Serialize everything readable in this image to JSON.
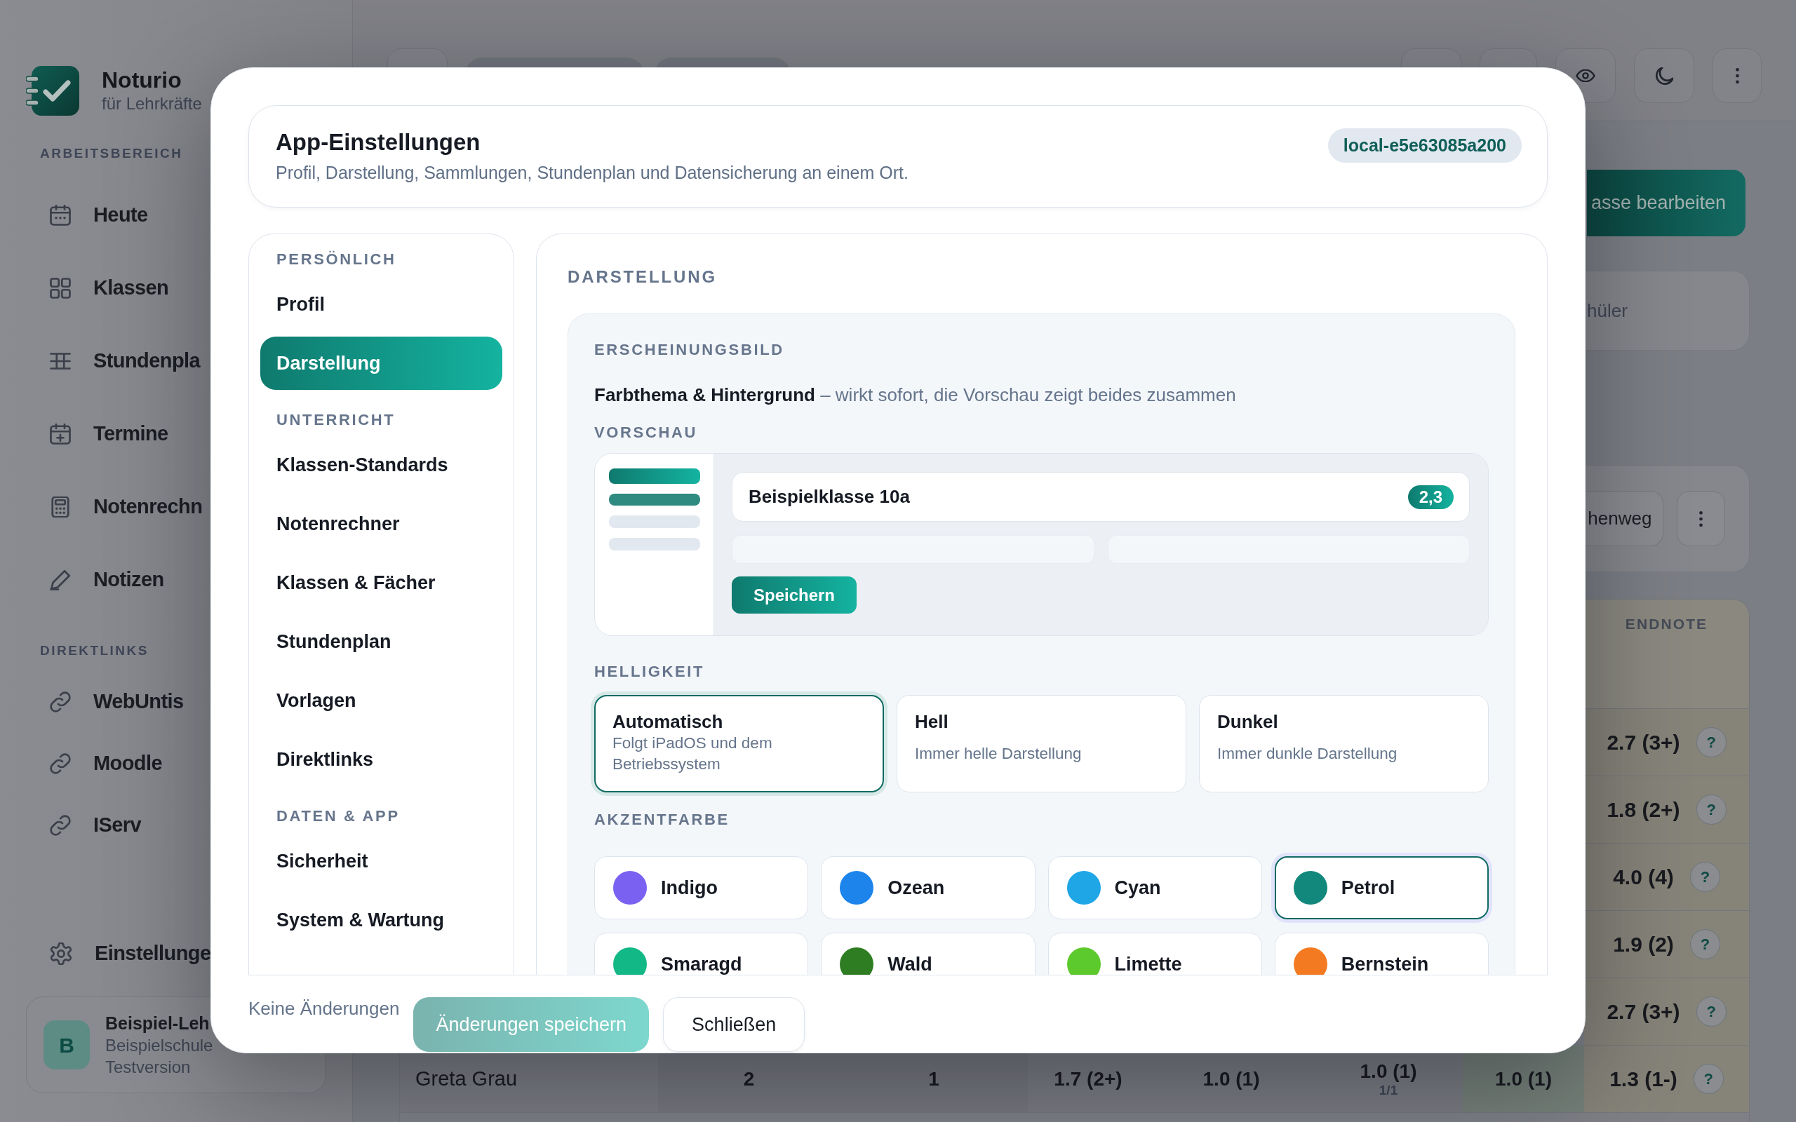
{
  "sidebar": {
    "app_name": "Noturio",
    "app_subtitle": "für Lehrkräfte",
    "sections": [
      {
        "heading": "ARBEITSBEREICH",
        "items": [
          {
            "label": "Heute"
          },
          {
            "label": "Klassen"
          },
          {
            "label": "Stundenpla"
          },
          {
            "label": "Termine"
          },
          {
            "label": "Notenrechn"
          },
          {
            "label": "Notizen"
          }
        ]
      },
      {
        "heading": "DIREKTLINKS",
        "items": [
          {
            "label": "WebUntis"
          },
          {
            "label": "Moodle"
          },
          {
            "label": "IServ"
          }
        ]
      }
    ],
    "settings_label": "Einstellunge",
    "user": {
      "initial": "B",
      "name": "Beispiel-Leh",
      "school": "Beispielschule",
      "plan": "Testversion"
    }
  },
  "main": {
    "edit_button": "asse bearbeiten",
    "students_card": "hüler",
    "action_button": "henweg",
    "grade_table": {
      "endnote_header": "ENDNOTE",
      "rows": [
        {
          "endnote": "2.7 (3+)",
          "help": "?"
        },
        {
          "endnote": "1.8 (2+)",
          "help": "?"
        },
        {
          "endnote": "4.0 (4)",
          "help": "?"
        },
        {
          "endnote": "1.9 (2)",
          "help": "?"
        },
        {
          "endnote": "2.7 (3+)",
          "help": "?"
        },
        {
          "name": "Greta Grau",
          "cells": [
            {
              "value": "2"
            },
            {
              "value": "1"
            },
            {
              "value": "1.7 (2+)"
            },
            {
              "value": "1.0 (1)"
            },
            {
              "value": "1.0 (1)",
              "sub": "1/1"
            },
            {
              "value": "1.0 (1)"
            }
          ],
          "endnote": "1.3 (1-)",
          "help": "?"
        }
      ]
    }
  },
  "dialog": {
    "title": "App-Einstellungen",
    "subtitle": "Profil, Darstellung, Sammlungen, Stundenplan und Datensicherung an einem Ort.",
    "badge": "local-e5e63085a200",
    "nav": [
      {
        "heading": "PERSÖNLICH",
        "items": [
          {
            "label": "Profil",
            "selected": false
          },
          {
            "label": "Darstellung",
            "selected": true
          }
        ]
      },
      {
        "heading": "UNTERRICHT",
        "items": [
          {
            "label": "Klassen-Standards",
            "selected": false
          },
          {
            "label": "Notenrechner",
            "selected": false
          },
          {
            "label": "Klassen & Fächer",
            "selected": false
          },
          {
            "label": "Stundenplan",
            "selected": false
          },
          {
            "label": "Vorlagen",
            "selected": false
          },
          {
            "label": "Direktlinks",
            "selected": false
          }
        ]
      },
      {
        "heading": "DATEN & APP",
        "items": [
          {
            "label": "Sicherheit",
            "selected": false
          },
          {
            "label": "System & Wartung",
            "selected": false
          }
        ]
      }
    ],
    "panel_title": "DARSTELLUNG",
    "section": {
      "title": "ERSCHEINUNGSBILD",
      "intro": "**Farbthema & Hintergrund** – wirkt sofort, die Vorschau zeigt beides zusammen",
      "preview": {
        "label": "VORSCHAU",
        "card_title": "Beispielklasse 10a",
        "card_badge": "2,3",
        "button": "Speichern"
      },
      "brightness": {
        "label": "HELLIGKEIT",
        "options": [
          {
            "title": "Automatisch",
            "description": "Folgt iPadOS und dem Betriebssystem",
            "selected": true
          },
          {
            "title": "Hell",
            "description": "Immer helle Darstellung",
            "selected": false
          },
          {
            "title": "Dunkel",
            "description": "Immer dunkle Darstellung",
            "selected": false
          }
        ]
      },
      "accent": {
        "label": "AKZENTFARBE",
        "options": [
          {
            "name": "Indigo",
            "color": "#7b61f2",
            "selected": false
          },
          {
            "name": "Ozean",
            "color": "#1d84ec",
            "selected": false
          },
          {
            "name": "Cyan",
            "color": "#1ea6e6",
            "selected": false
          },
          {
            "name": "Petrol",
            "color": "#11887b",
            "selected": true
          },
          {
            "name": "Smaragd",
            "color": "#12b886",
            "selected": false
          },
          {
            "name": "Wald",
            "color": "#2e7d22",
            "selected": false
          },
          {
            "name": "Limette",
            "color": "#5cc92c",
            "selected": false
          },
          {
            "name": "Bernstein",
            "color": "#f47a22",
            "selected": false
          }
        ]
      }
    },
    "footer": {
      "status": "Keine Änderungen",
      "save_button": {
        "label": "Änderungen speichern",
        "disabled": true
      },
      "close_button": "Schließen"
    }
  }
}
